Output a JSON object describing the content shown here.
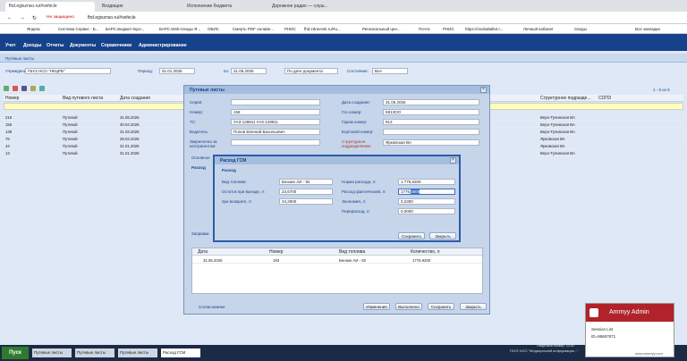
{
  "browser": {
    "tabs": [
      "fhd.egisznso.ru/#vehicle",
      "Входящие",
      "Исполнение бюджета",
      "Дорожное радио — слуш..."
    ],
    "url": "fhd.egisznso.ru/#vehicle",
    "insecure": "Не защищено"
  },
  "bookmarks": [
    "Яндекс",
    "Система Сервис - Б...",
    "БАРС.Бюджет-Бухг...",
    "БАРС.Web-Своды Я...",
    "ОБИС",
    "Смерть PDF онлайн...",
    "РНИС",
    "fhd.zdravnsk.ru/#u...",
    "Региональный цен...",
    "Почта",
    "РНИС",
    "https://ssobaltal54.r...",
    "Личный кабинет",
    "Своды",
    "Все закладки"
  ],
  "menu": [
    "Учет",
    "Доходы",
    "Отчеты",
    "Документы",
    "Справочники",
    "Администрирование"
  ],
  "panel_title": "Путевые листы",
  "filters": {
    "inst_label": "Учреждение:",
    "inst": "ГБУЗ НСО \"НКЦРБ\"",
    "period_label": "Период:",
    "from": "01.01.2026",
    "to_label": "по:",
    "to": "31.06.2026",
    "date_mode": "По дате документа",
    "state_label": "Состояние:",
    "state": "Все",
    "paging": "1 - 6 из 6"
  },
  "grid": {
    "headers": [
      "Номер",
      "Вид путевого листа",
      "Дата создания",
      "Структурное подразде...",
      "СОПЗ"
    ],
    "rows": [
      [
        "216",
        "Путевой",
        "31.05.2026",
        "Веро-Тулинская ВА"
      ],
      [
        "156",
        "Путевой",
        "30.04.2026",
        "Веро-Тулинская ВА"
      ],
      [
        "138",
        "Путевой",
        "31.03.2026",
        "Веро-Тулинская ВА"
      ],
      [
        "75",
        "Путевой",
        "28.02.2026",
        "Ярковская ВА"
      ],
      [
        "44",
        "Путевой",
        "31.01.2026",
        "Ярковская ВА"
      ],
      [
        "13",
        "Путевой",
        "31.01.2026",
        "Веро-Тулинская ВА"
      ]
    ]
  },
  "outer": {
    "title": "Путевые листы",
    "series": "Серия:",
    "number": "Номер:",
    "number_val": "158",
    "ts": "ТС:",
    "ts_val": "УАЗ-128811 УАЗ-128811",
    "driver": "Водитель:",
    "driver_val": "Попов Евгений Васильевич",
    "contr": "Закреплена за контрагентом:",
    "created": "Дата создания:",
    "created_val": "31.05.2026",
    "garage": "Гос.номер:",
    "garage_val": "К813ОО",
    "garnum": "Гараж.номер:",
    "garnum_val": "813",
    "board": "Бортовой номер:",
    "struct": "Структурное подразделение:",
    "struct_val": "Ярковская ВА",
    "tab1": "Основное",
    "sec": "Расход",
    "zapr": "Заправки",
    "zcols": [
      "Дата",
      "Номер",
      "Вид топлива",
      "Количество, л"
    ],
    "zrow": [
      "31.05.2026",
      "193",
      "Бензин АИ - 92",
      "1776.9200"
    ],
    "conf": "Согласование",
    "actions": [
      "Изменения",
      "Выполнено",
      "Сохранить",
      "Закрыть"
    ]
  },
  "dialog": {
    "title": "Расход ГСМ",
    "group": "Расход",
    "fuel_l": "Вид топлива:",
    "fuel": "Бензин АИ - 92",
    "rest_out_l": "Остаток при выезде, л:",
    "rest_out": "23,6700",
    "rest_in_l": "при возврате, л:",
    "rest_in": "34,2900",
    "norm_l": "Норма расхода, л:",
    "norm": "1 776,5300",
    "fact_l": "Расход фактический, л:",
    "fact_pre": "1776,",
    "fact_sel": "3000",
    "econ_l": "Экономия, л:",
    "econ": "0,2300",
    "over_l": "Перерасход, л:",
    "over": "0,0000",
    "save": "Сохранить",
    "close": "Закрыть"
  },
  "taskbar": {
    "start": "Пуск",
    "items": [
      "Путевые листы",
      "Путевые листы",
      "Путевые листы",
      "Расход ГСМ"
    ],
    "footer1": "Лицензия номер: 1216",
    "footer2": "ГБУЗ НСО \"Медицинский информацио...\""
  },
  "ammyy": {
    "title": "Ammyy Admin",
    "list": "Session List",
    "id": "ID=95657871",
    "site": "www.ammyy.com"
  }
}
